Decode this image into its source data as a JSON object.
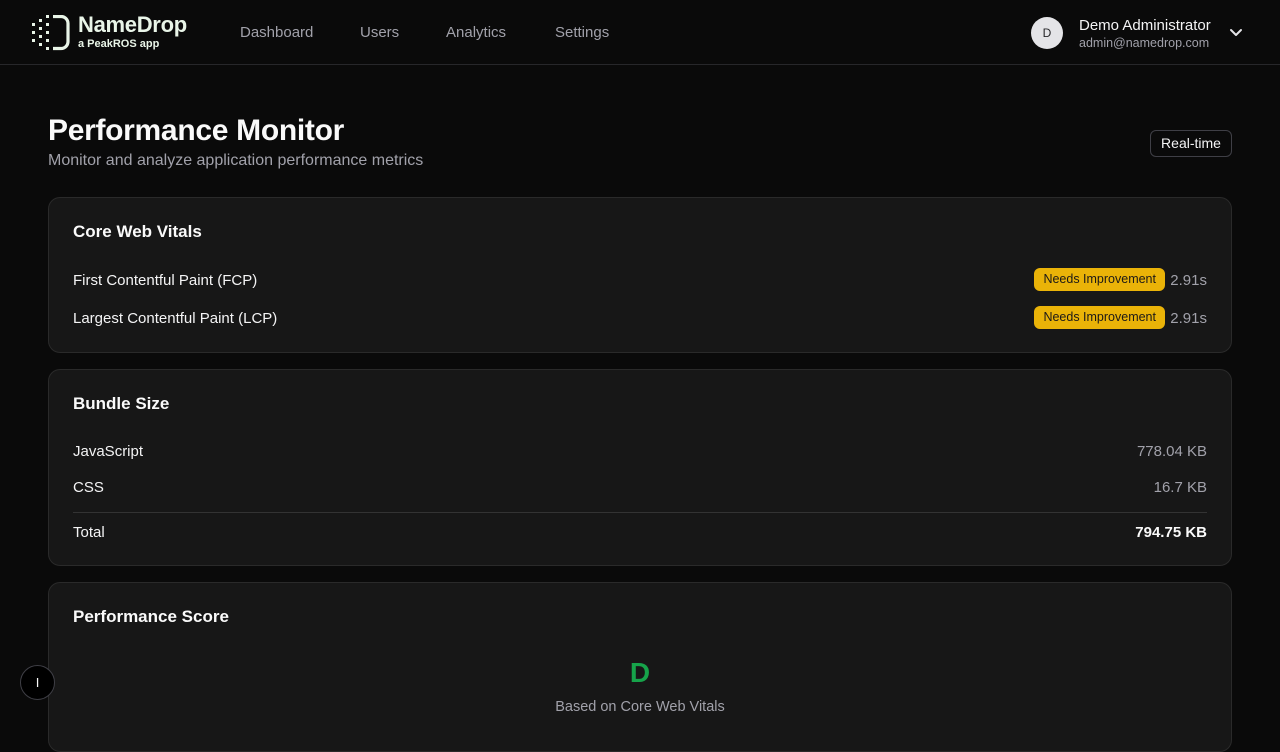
{
  "brand": {
    "name": "NameDrop",
    "tagline": "a PeakROS app"
  },
  "nav": {
    "items": [
      {
        "label": "Dashboard"
      },
      {
        "label": "Users"
      },
      {
        "label": "Analytics"
      },
      {
        "label": "Settings"
      }
    ]
  },
  "user": {
    "initial": "D",
    "name": "Demo Administrator",
    "email": "admin@namedrop.com",
    "menu_icon": "chevron-down-icon"
  },
  "page": {
    "title": "Performance Monitor",
    "subtitle": "Monitor and analyze application performance metrics",
    "mode_badge": "Real-time"
  },
  "core_web_vitals": {
    "title": "Core Web Vitals",
    "metrics": [
      {
        "label": "First Contentful Paint (FCP)",
        "status": "Needs Improvement",
        "value": "2.91s"
      },
      {
        "label": "Largest Contentful Paint (LCP)",
        "status": "Needs Improvement",
        "value": "2.91s"
      }
    ],
    "status_color": "#eab308"
  },
  "bundle_size": {
    "title": "Bundle Size",
    "items": [
      {
        "label": "JavaScript",
        "value": "778.04 KB"
      },
      {
        "label": "CSS",
        "value": "16.7 KB"
      }
    ],
    "total": {
      "label": "Total",
      "value": "794.75 KB"
    }
  },
  "performance_score": {
    "title": "Performance Score",
    "grade": "D",
    "caption": "Based on Core Web Vitals",
    "grade_color": "#16a34a"
  },
  "floating_button": {
    "label": "I"
  }
}
